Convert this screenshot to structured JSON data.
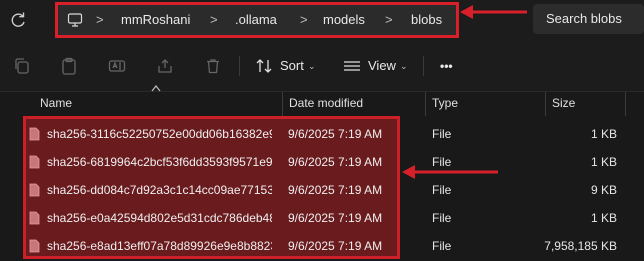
{
  "breadcrumb": {
    "items": [
      "mmRoshani",
      ".ollama",
      "models",
      "blobs"
    ],
    "separator": ">"
  },
  "search": {
    "placeholder": "Search blobs"
  },
  "toolbar": {
    "sort_label": "Sort",
    "view_label": "View",
    "more_label": "•••"
  },
  "columns": {
    "name": "Name",
    "date": "Date modified",
    "type": "Type",
    "size": "Size"
  },
  "files": [
    {
      "name": "sha256-3116c52250752e00dd06b16382e9...",
      "date": "9/6/2025 7:19 AM",
      "type": "File",
      "size": "1 KB"
    },
    {
      "name": "sha256-6819964c2bcf53f6dd3593f9571e9...",
      "date": "9/6/2025 7:19 AM",
      "type": "File",
      "size": "1 KB"
    },
    {
      "name": "sha256-dd084c7d92a3c1c14cc09ae77153...",
      "date": "9/6/2025 7:19 AM",
      "type": "File",
      "size": "9 KB"
    },
    {
      "name": "sha256-e0a42594d802e5d31cdc786deb48...",
      "date": "9/6/2025 7:19 AM",
      "type": "File",
      "size": "1 KB"
    },
    {
      "name": "sha256-e8ad13eff07a78d89926e9e8b8823...",
      "date": "9/6/2025 7:19 AM",
      "type": "File",
      "size": "7,958,185 KB"
    }
  ],
  "colors": {
    "annotation_red": "#d8202a",
    "selection_fill": "#6a1b1e",
    "background": "#191919"
  }
}
